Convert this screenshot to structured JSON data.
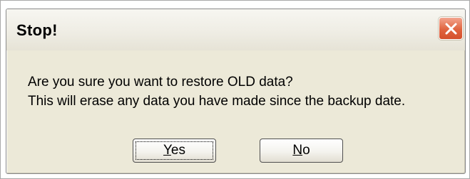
{
  "dialog": {
    "title": "Stop!",
    "message_line1": "Are you sure you want to restore OLD data?",
    "message_line2": "This will erase any data you have made since the backup date.",
    "close_icon": "close-x-icon"
  },
  "buttons": {
    "yes": {
      "mnemonic": "Y",
      "rest": "es",
      "focused": true
    },
    "no": {
      "mnemonic": "N",
      "rest": "o",
      "focused": false
    }
  },
  "colors": {
    "dialog_face": "#ece9d8",
    "close_button": "#e0643f"
  }
}
